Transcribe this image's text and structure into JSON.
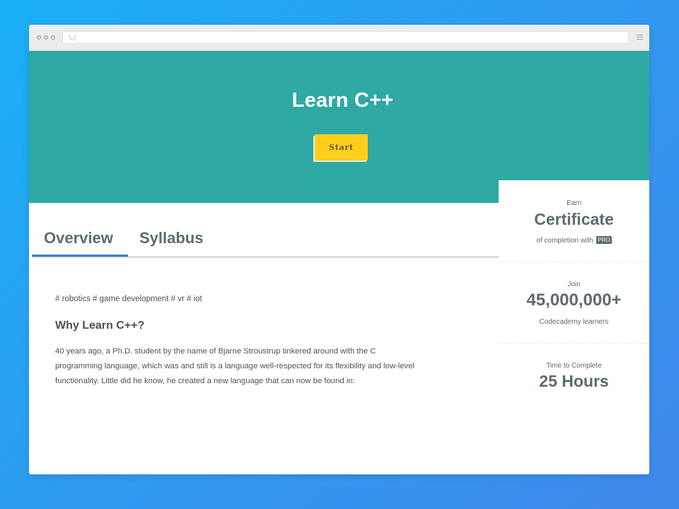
{
  "browser": {
    "url": ""
  },
  "hero": {
    "title": "Learn C++",
    "start_label": "Start"
  },
  "tabs": [
    {
      "label": "Overview",
      "active": true
    },
    {
      "label": "Syllabus",
      "active": false
    }
  ],
  "overview": {
    "tags": "# robotics # game development # vr # iot",
    "heading": "Why Learn C++?",
    "body_lines": [
      "40 years ago, a Ph.D. student by the name of Bjarne Stroustrup tinkered around with the C",
      "programming language, which was and still is a language well-respected for its flexibility and low-level",
      "functionality. Little did he know, he created a new language that can now be found in:"
    ]
  },
  "sidebar": {
    "certificate": {
      "label": "Earn",
      "value": "Certificate",
      "caption": "of completion with",
      "badge": "PRO"
    },
    "learners": {
      "label": "Join",
      "value": "45,000,000+",
      "caption": "Codecademy learners"
    },
    "time": {
      "label": "Time to Complete",
      "value": "25 Hours"
    }
  },
  "colors": {
    "background_start": "#1ab0f5",
    "background_end": "#3f88ea",
    "hero": "#2ea9a4",
    "start_button": "#ffce1c",
    "tab_underline": "#3e7fd6",
    "text": "#4b5257"
  },
  "icons": [
    "window-dot-icon",
    "reload-icon",
    "menu-icon"
  ]
}
